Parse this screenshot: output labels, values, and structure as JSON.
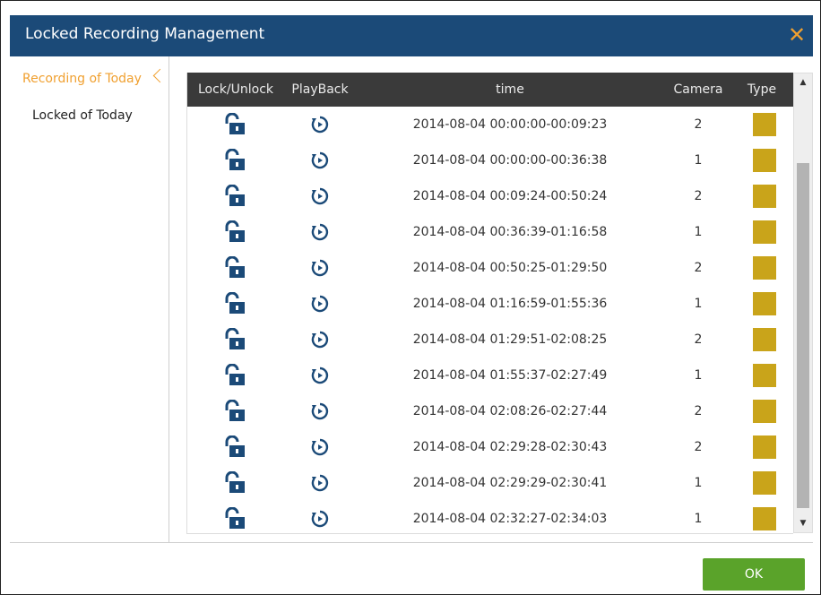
{
  "dialog": {
    "title": "Locked Recording Management",
    "close_symbol": "✕"
  },
  "sidebar": {
    "items": [
      {
        "label": "Recording of Today",
        "active": true
      },
      {
        "label": "Locked of Today",
        "active": false
      }
    ]
  },
  "table": {
    "headers": [
      "Lock/Unlock",
      "PlayBack",
      "time",
      "Camera",
      "Type"
    ],
    "rows": [
      {
        "time": "2014-08-04 00:00:00-00:09:23",
        "camera": "2"
      },
      {
        "time": "2014-08-04 00:00:00-00:36:38",
        "camera": "1"
      },
      {
        "time": "2014-08-04 00:09:24-00:50:24",
        "camera": "2"
      },
      {
        "time": "2014-08-04 00:36:39-01:16:58",
        "camera": "1"
      },
      {
        "time": "2014-08-04 00:50:25-01:29:50",
        "camera": "2"
      },
      {
        "time": "2014-08-04 01:16:59-01:55:36",
        "camera": "1"
      },
      {
        "time": "2014-08-04 01:29:51-02:08:25",
        "camera": "2"
      },
      {
        "time": "2014-08-04 01:55:37-02:27:49",
        "camera": "1"
      },
      {
        "time": "2014-08-04 02:08:26-02:27:44",
        "camera": "2"
      },
      {
        "time": "2014-08-04 02:29:28-02:30:43",
        "camera": "2"
      },
      {
        "time": "2014-08-04 02:29:29-02:30:41",
        "camera": "1"
      },
      {
        "time": "2014-08-04 02:32:27-02:34:03",
        "camera": "1"
      }
    ],
    "lock_icon": "unlock-icon",
    "playback_icon": "playback-icon",
    "type_color": "#c9a41a"
  },
  "footer": {
    "ok_label": "OK"
  },
  "colors": {
    "titlebar": "#1b4a78",
    "accent": "#f0a030",
    "ok": "#5aa32a",
    "header": "#3a3a3a"
  }
}
